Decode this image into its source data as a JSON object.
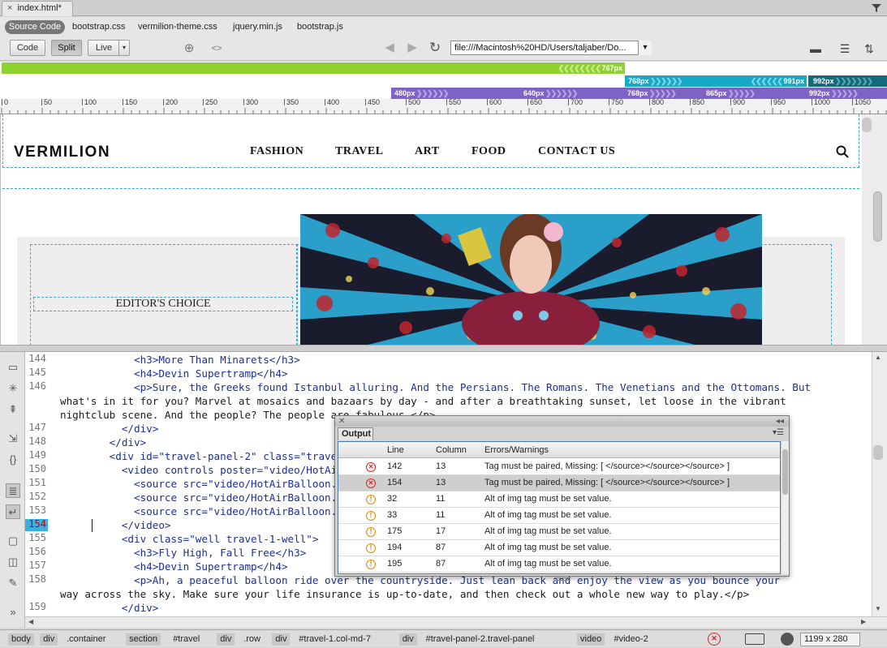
{
  "tab": {
    "title": "index.html*",
    "close": "×"
  },
  "related_files": {
    "source_code": "Source Code",
    "files": [
      "bootstrap.css",
      "vermilion-theme.css",
      "jquery.min.js",
      "bootstrap.js"
    ]
  },
  "view_modes": {
    "code": "Code",
    "split": "Split",
    "live": "Live",
    "active": "Split"
  },
  "address": {
    "url": "file:///Macintosh%20HD/Users/taljaber/Do..."
  },
  "media_queries": {
    "row1": [
      "767px"
    ],
    "row2": [
      "768px",
      "991px",
      "992px"
    ],
    "row3": [
      "480px",
      "640px",
      "768px",
      "865px",
      "992px"
    ]
  },
  "ruler": {
    "ticks": [
      "0",
      "50",
      "100",
      "150",
      "200",
      "250",
      "300",
      "350",
      "400",
      "450",
      "500",
      "550",
      "600",
      "650",
      "700",
      "750",
      "800",
      "850",
      "900",
      "950",
      "1000",
      "1050"
    ]
  },
  "site": {
    "logo": "VERMILION",
    "nav": [
      "FASHION",
      "TRAVEL",
      "ART",
      "FOOD",
      "CONTACT US"
    ],
    "editors_choice": "EDITOR'S CHOICE"
  },
  "code": {
    "current_line": "154",
    "lines": [
      {
        "n": "144",
        "text": "            <h3>More Than Minarets</h3>"
      },
      {
        "n": "145",
        "text": "            <h4>Devin Supertramp</h4>"
      },
      {
        "n": "146",
        "text": "            <p>Sure, the Greeks found Istanbul alluring. And the Persians. The Romans. The Venetians and the Ottomans. But"
      },
      {
        "n": "",
        "text": "what's in it for you? Marvel at mosaics and bazaars by day - and after a breathtaking sunset, let loose in the vibrant"
      },
      {
        "n": "",
        "text": "nightclub scene. And the people? The people are fabulous.</p>"
      },
      {
        "n": "147",
        "text": "          </div>"
      },
      {
        "n": "148",
        "text": "        </div>"
      },
      {
        "n": "149",
        "text": "        <div id=\"travel-panel-2\" class=\"travel-panel\">"
      },
      {
        "n": "150",
        "text": "          <video controls poster=\"video/HotAirBalloon.jpg\">"
      },
      {
        "n": "151",
        "text": "            <source src=\"video/HotAirBalloon.mp4\">"
      },
      {
        "n": "152",
        "text": "            <source src=\"video/HotAirBalloon.ogg\">"
      },
      {
        "n": "153",
        "text": "            <source src=\"video/HotAirBalloon.webm\">"
      },
      {
        "n": "154",
        "text": "          </video>"
      },
      {
        "n": "155",
        "text": "          <div class=\"well travel-1-well\">"
      },
      {
        "n": "156",
        "text": "            <h3>Fly High, Fall Free</h3>"
      },
      {
        "n": "157",
        "text": "            <h4>Devin Supertramp</h4>"
      },
      {
        "n": "158",
        "text": "            <p>Ah, a peaceful balloon ride over the countryside. Just lean back and enjoy the view as you bounce your"
      },
      {
        "n": "",
        "text": "way across the sky. Make sure your life insurance is up-to-date, and then check out a whole new way to play.</p>"
      },
      {
        "n": "159",
        "text": "          </div>"
      }
    ]
  },
  "output_panel": {
    "title": "Output",
    "columns": [
      "Line",
      "Column",
      "Errors/Warnings"
    ],
    "rows": [
      {
        "type": "error",
        "line": "142",
        "col": "13",
        "msg": "Tag must be paired, Missing: [ </source></source></source> ]"
      },
      {
        "type": "error",
        "line": "154",
        "col": "13",
        "msg": "Tag must be paired, Missing: [ </source></source></source> ]",
        "selected": true
      },
      {
        "type": "warning",
        "line": "32",
        "col": "11",
        "msg": "Alt of img tag must be set value."
      },
      {
        "type": "warning",
        "line": "33",
        "col": "11",
        "msg": "Alt of img tag must be set value."
      },
      {
        "type": "warning",
        "line": "175",
        "col": "17",
        "msg": "Alt of img tag must be set value."
      },
      {
        "type": "warning",
        "line": "194",
        "col": "87",
        "msg": "Alt of img tag must be set value."
      },
      {
        "type": "warning",
        "line": "195",
        "col": "87",
        "msg": "Alt of img tag must be set value."
      }
    ]
  },
  "status": {
    "breadcrumbs": [
      "body",
      "div",
      ".container",
      "section",
      "#travel",
      "div",
      ".row",
      "div",
      "#travel-1.col-md-7",
      "div",
      "#travel-panel-2.travel-panel",
      "video",
      "#video-2"
    ],
    "size": "1199 x 280"
  },
  "colors": {
    "mq_green": "#8fd22e",
    "mq_teal": "#18a9c7",
    "mq_dark": "#146a7a",
    "mq_purple": "#7f63c4",
    "guide": "#38a8c8"
  }
}
